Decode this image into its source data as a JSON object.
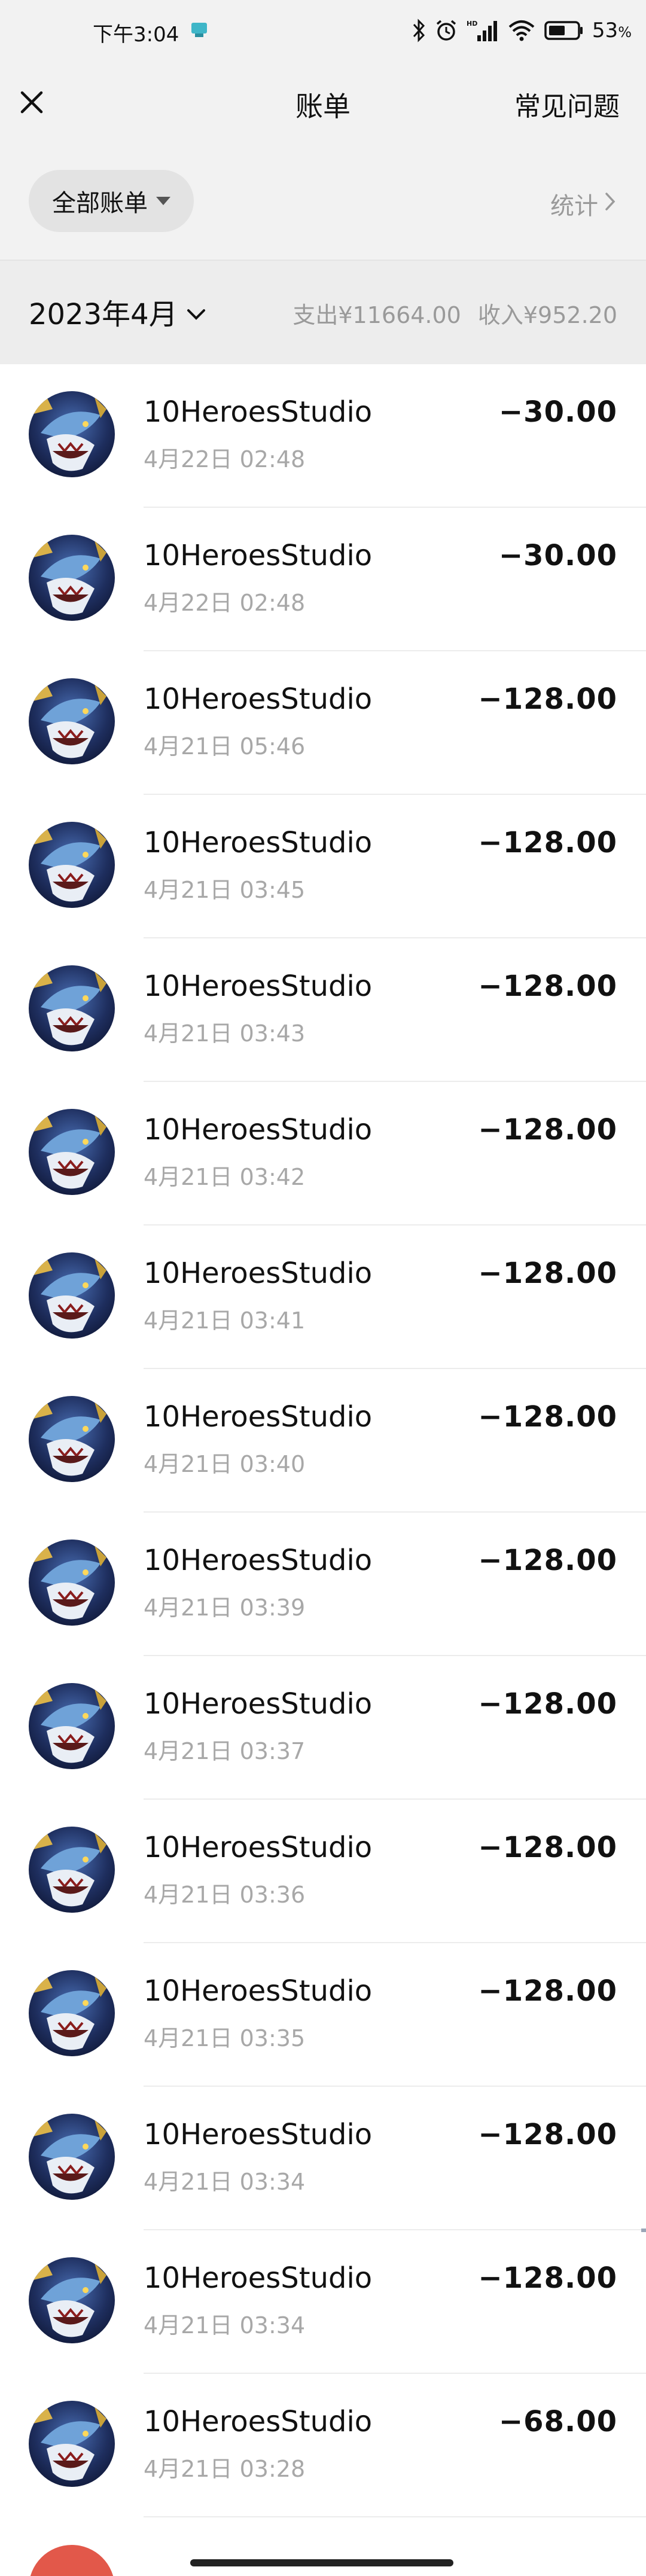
{
  "status_bar": {
    "time": "下午3:04",
    "battery": "53",
    "battery_unit": "%",
    "network_badge": "HD"
  },
  "nav": {
    "title": "账单",
    "faq_label": "常见问题",
    "close_icon": "close-icon"
  },
  "filter": {
    "label": "全部账单",
    "stats_label": "统计"
  },
  "summary": {
    "month": "2023年4月",
    "expense": "支出¥11664.00",
    "income": "收入¥952.20"
  },
  "transactions": [
    {
      "name": "10HeroesStudio",
      "time": "4月22日 02:48",
      "amount": "−30.00"
    },
    {
      "name": "10HeroesStudio",
      "time": "4月22日 02:48",
      "amount": "−30.00"
    },
    {
      "name": "10HeroesStudio",
      "time": "4月21日 05:46",
      "amount": "−128.00"
    },
    {
      "name": "10HeroesStudio",
      "time": "4月21日 03:45",
      "amount": "−128.00"
    },
    {
      "name": "10HeroesStudio",
      "time": "4月21日 03:43",
      "amount": "−128.00"
    },
    {
      "name": "10HeroesStudio",
      "time": "4月21日 03:42",
      "amount": "−128.00"
    },
    {
      "name": "10HeroesStudio",
      "time": "4月21日 03:41",
      "amount": "−128.00"
    },
    {
      "name": "10HeroesStudio",
      "time": "4月21日 03:40",
      "amount": "−128.00"
    },
    {
      "name": "10HeroesStudio",
      "time": "4月21日 03:39",
      "amount": "−128.00"
    },
    {
      "name": "10HeroesStudio",
      "time": "4月21日 03:37",
      "amount": "−128.00"
    },
    {
      "name": "10HeroesStudio",
      "time": "4月21日 03:36",
      "amount": "−128.00"
    },
    {
      "name": "10HeroesStudio",
      "time": "4月21日 03:35",
      "amount": "−128.00"
    },
    {
      "name": "10HeroesStudio",
      "time": "4月21日 03:34",
      "amount": "−128.00"
    },
    {
      "name": "10HeroesStudio",
      "time": "4月21日 03:34",
      "amount": "−128.00"
    },
    {
      "name": "10HeroesStudio",
      "time": "4月21日 03:28",
      "amount": "−68.00"
    }
  ],
  "colors": {
    "header_bg": "#f2f2f2",
    "summary_bg": "#ededed",
    "secondary_text": "#9a9a9a",
    "primary_text": "#111111"
  }
}
